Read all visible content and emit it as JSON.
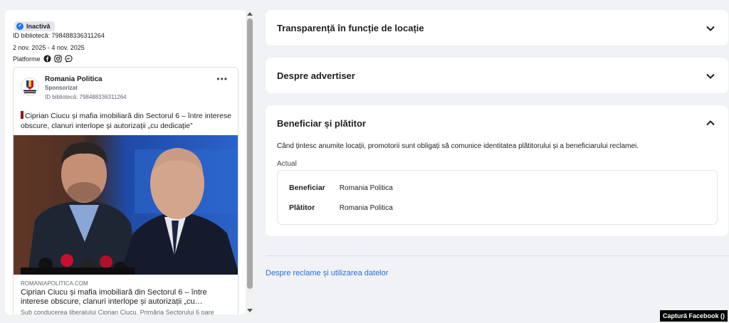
{
  "left": {
    "status": "Inactivă",
    "library_id": "ID bibliotecă: 798488336311264",
    "dates": "2 nov. 2025 - 4 nov. 2025",
    "platforms_label": "Platforme",
    "platform_icons": [
      "facebook-icon",
      "instagram-icon",
      "messenger-icon"
    ]
  },
  "ad": {
    "advertiser": "Romania Politica",
    "sponsored": "Sponsorizat",
    "library_id": "ID bibliotecă: 798488336311264",
    "logo_text": "ROMANIA POLITICA",
    "text": "Ciprian Ciucu și mafia imobiliară din Sectorul 6 – între interese obscure, clanuri interlope și autorizații „cu dedicație”",
    "domain": "ROMANIAPOLITICA.COM",
    "headline": "Ciprian Ciucu și mafia imobiliară din Sectorul 6 – între interese obscure, clanuri interlope și autorizații „cu…",
    "description": "Sub conducerea liberalului Ciprian Ciucu, Primăria Sectorului 6 pare"
  },
  "panels": {
    "transparency": "Transparență în funcție de locație",
    "about_advertiser": "Despre advertiser",
    "beneficiary": {
      "title": "Beneficiar și plătitor",
      "description": "Când țintesc anumite locații, promotorii sunt obligați să comunice identitatea plătitorului și a beneficiarului reclamei.",
      "current_label": "Actual",
      "rows": [
        {
          "label": "Beneficiar",
          "value": "Romania Politica"
        },
        {
          "label": "Plătitor",
          "value": "Romania Politica"
        }
      ]
    }
  },
  "footer_link": "Despre reclame și utilizarea datelor",
  "caption": "Captură Facebook ()",
  "colors": {
    "accent": "#1877f2",
    "link": "#216fdb",
    "background": "#f0f2f5"
  }
}
